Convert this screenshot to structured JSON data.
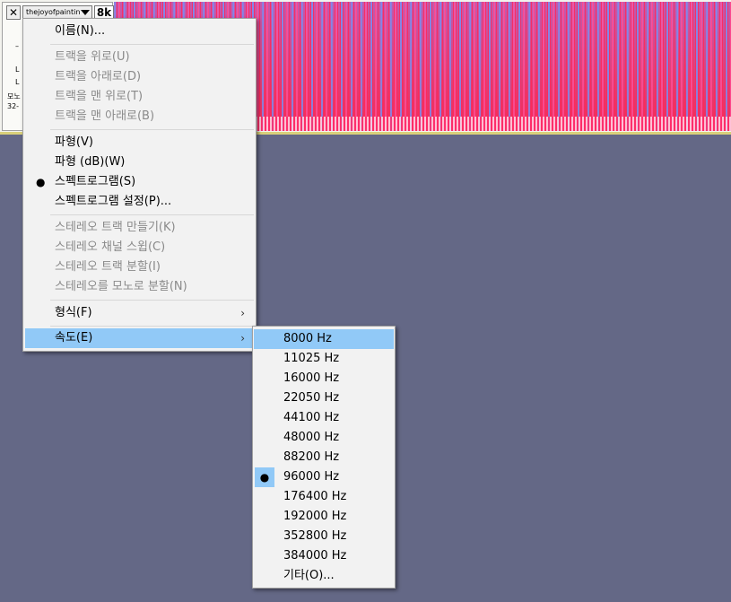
{
  "track": {
    "close_label": "✕",
    "name": "thejoyofpaintin",
    "rate": "8k",
    "labels": [
      "–",
      "L",
      "L",
      "모노",
      "32-"
    ]
  },
  "context_menu": {
    "items": [
      {
        "label": "이름(N)...",
        "enabled": true
      },
      {
        "label": "트랙을 위로(U)",
        "enabled": false
      },
      {
        "label": "트랙을 아래로(D)",
        "enabled": false
      },
      {
        "label": "트랙을 맨 위로(T)",
        "enabled": false
      },
      {
        "label": "트랙을 맨 아래로(B)",
        "enabled": false
      },
      {
        "label": "파형(V)",
        "enabled": true
      },
      {
        "label": "파형 (dB)(W)",
        "enabled": true
      },
      {
        "label": "스펙트로그램(S)",
        "enabled": true,
        "checked": true
      },
      {
        "label": "스펙트로그램 설정(P)...",
        "enabled": true
      },
      {
        "label": "스테레오 트랙 만들기(K)",
        "enabled": false
      },
      {
        "label": "스테레오 채널 스윕(C)",
        "enabled": false
      },
      {
        "label": "스테레오 트랙 분할(I)",
        "enabled": false
      },
      {
        "label": "스테레오를 모노로 분할(N)",
        "enabled": false
      },
      {
        "label": "형식(F)",
        "enabled": true,
        "submenu": true
      },
      {
        "label": "속도(E)",
        "enabled": true,
        "submenu": true,
        "highlighted": true
      }
    ]
  },
  "rate_submenu": {
    "items": [
      {
        "label": "8000 Hz",
        "highlighted": true
      },
      {
        "label": "11025 Hz"
      },
      {
        "label": "16000 Hz"
      },
      {
        "label": "22050 Hz"
      },
      {
        "label": "44100 Hz"
      },
      {
        "label": "48000 Hz"
      },
      {
        "label": "88200 Hz"
      },
      {
        "label": "96000 Hz",
        "checked": true
      },
      {
        "label": "176400 Hz"
      },
      {
        "label": "192000 Hz"
      },
      {
        "label": "352800 Hz"
      },
      {
        "label": "384000 Hz"
      },
      {
        "label": "기타(O)..."
      }
    ]
  },
  "glyphs": {
    "bullet": "●",
    "submenu_arrow": "›"
  },
  "colors": {
    "background": "#646886",
    "highlight": "#91c9f7",
    "menu_bg": "#f2f2f2",
    "disabled_text": "#8a8a8a"
  }
}
